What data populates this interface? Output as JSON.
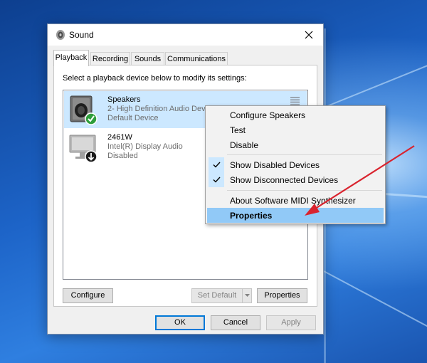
{
  "window": {
    "title": "Sound"
  },
  "tabs": [
    "Playback",
    "Recording",
    "Sounds",
    "Communications"
  ],
  "playback": {
    "instructions": "Select a playback device below to modify its settings:",
    "devices": [
      {
        "name": "Speakers",
        "subtitle": "2- High Definition Audio Device",
        "status": "Default Device"
      },
      {
        "name": "2461W",
        "subtitle": "Intel(R) Display Audio",
        "status": "Disabled"
      }
    ],
    "buttons": {
      "configure": "Configure",
      "set_default": "Set Default",
      "properties": "Properties"
    }
  },
  "dialog_buttons": {
    "ok": "OK",
    "cancel": "Cancel",
    "apply": "Apply"
  },
  "context_menu": {
    "items": [
      {
        "label": "Configure Speakers"
      },
      {
        "label": "Test"
      },
      {
        "label": "Disable"
      },
      {
        "label": "Show Disabled Devices",
        "checked": true
      },
      {
        "label": "Show Disconnected Devices",
        "checked": true
      },
      {
        "label": "About Software MIDI Synthesizer"
      },
      {
        "label": "Properties",
        "highlighted": true
      }
    ]
  },
  "colors": {
    "accent": "#0078d7",
    "selection": "#cce8ff",
    "menu_highlight": "#91c9f7",
    "annotation_arrow": "#d9232e"
  }
}
